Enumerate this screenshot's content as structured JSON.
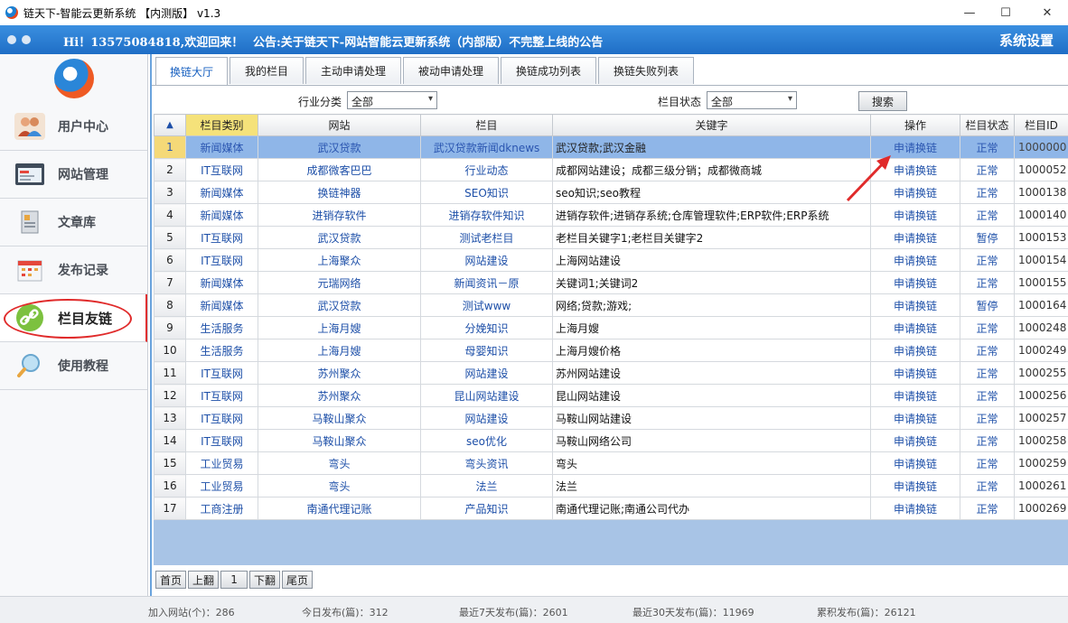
{
  "window": {
    "title": "链天下-智能云更新系统 【内测版】 v1.3",
    "minimize": "—",
    "maximize": "☐",
    "close": "✕"
  },
  "header": {
    "welcome": "Hi！13575084818,欢迎回来！",
    "notice": "公告:关于链天下-网站智能云更新系统（内部版）不完整上线的公告",
    "settings": "系统设置"
  },
  "sidebar": {
    "items": [
      {
        "label": "用户中心",
        "icon": "users-icon"
      },
      {
        "label": "网站管理",
        "icon": "browser-window-icon"
      },
      {
        "label": "文章库",
        "icon": "document-icon"
      },
      {
        "label": "发布记录",
        "icon": "calendar-icon"
      },
      {
        "label": "栏目友链",
        "icon": "link-icon",
        "active": true
      },
      {
        "label": "使用教程",
        "icon": "magnifier-icon"
      }
    ]
  },
  "tabs": [
    "换链大厅",
    "我的栏目",
    "主动申请处理",
    "被动申请处理",
    "换链成功列表",
    "换链失败列表"
  ],
  "filters": {
    "industry_label": "行业分类",
    "industry_value": "全部",
    "status_label": "栏目状态",
    "status_value": "全部",
    "search_button": "搜索"
  },
  "table": {
    "columns": [
      "",
      "栏目类别",
      "网站",
      "栏目",
      "关键字",
      "操作",
      "栏目状态",
      "栏目ID"
    ],
    "sort_indicator": "▲",
    "rows": [
      {
        "n": "1",
        "cat": "新闻媒体",
        "site": "武汉贷款",
        "col": "武汉贷款新闻dknews",
        "kw": "武汉贷款;武汉金融",
        "op": "申请换链",
        "status": "正常",
        "id": "1000000"
      },
      {
        "n": "2",
        "cat": "IT互联网",
        "site": "成都微客巴巴",
        "col": "行业动态",
        "kw": "成都网站建设；成都三级分销；成都微商城",
        "op": "申请换链",
        "status": "正常",
        "id": "1000052"
      },
      {
        "n": "3",
        "cat": "新闻媒体",
        "site": "换链神器",
        "col": "SEO知识",
        "kw": "seo知识;seo教程",
        "op": "申请换链",
        "status": "正常",
        "id": "1000138"
      },
      {
        "n": "4",
        "cat": "新闻媒体",
        "site": "进销存软件",
        "col": "进销存软件知识",
        "kw": "进销存软件;进销存系统;仓库管理软件;ERP软件;ERP系统",
        "op": "申请换链",
        "status": "正常",
        "id": "1000140"
      },
      {
        "n": "5",
        "cat": "IT互联网",
        "site": "武汉贷款",
        "col": "测试老栏目",
        "kw": "老栏目关键字1;老栏目关键字2",
        "op": "申请换链",
        "status": "暂停",
        "id": "1000153"
      },
      {
        "n": "6",
        "cat": "IT互联网",
        "site": "上海聚众",
        "col": "网站建设",
        "kw": "上海网站建设",
        "op": "申请换链",
        "status": "正常",
        "id": "1000154"
      },
      {
        "n": "7",
        "cat": "新闻媒体",
        "site": "元瑞网络",
        "col": "新闻资讯－原",
        "kw": "关键词1;关键词2",
        "op": "申请换链",
        "status": "正常",
        "id": "1000155"
      },
      {
        "n": "8",
        "cat": "新闻媒体",
        "site": "武汉贷款",
        "col": "测试www",
        "kw": "网络;贷款;游戏;",
        "op": "申请换链",
        "status": "暂停",
        "id": "1000164"
      },
      {
        "n": "9",
        "cat": "生活服务",
        "site": "上海月嫂",
        "col": "分娩知识",
        "kw": "上海月嫂",
        "op": "申请换链",
        "status": "正常",
        "id": "1000248"
      },
      {
        "n": "10",
        "cat": "生活服务",
        "site": "上海月嫂",
        "col": "母婴知识",
        "kw": "上海月嫂价格",
        "op": "申请换链",
        "status": "正常",
        "id": "1000249"
      },
      {
        "n": "11",
        "cat": "IT互联网",
        "site": "苏州聚众",
        "col": "网站建设",
        "kw": "苏州网站建设",
        "op": "申请换链",
        "status": "正常",
        "id": "1000255"
      },
      {
        "n": "12",
        "cat": "IT互联网",
        "site": "苏州聚众",
        "col": "昆山网站建设",
        "kw": "昆山网站建设",
        "op": "申请换链",
        "status": "正常",
        "id": "1000256"
      },
      {
        "n": "13",
        "cat": "IT互联网",
        "site": "马鞍山聚众",
        "col": "网站建设",
        "kw": "马鞍山网站建设",
        "op": "申请换链",
        "status": "正常",
        "id": "1000257"
      },
      {
        "n": "14",
        "cat": "IT互联网",
        "site": "马鞍山聚众",
        "col": "seo优化",
        "kw": "马鞍山网络公司",
        "op": "申请换链",
        "status": "正常",
        "id": "1000258"
      },
      {
        "n": "15",
        "cat": "工业贸易",
        "site": "弯头",
        "col": "弯头资讯",
        "kw": "弯头",
        "op": "申请换链",
        "status": "正常",
        "id": "1000259"
      },
      {
        "n": "16",
        "cat": "工业贸易",
        "site": "弯头",
        "col": "法兰",
        "kw": "法兰",
        "op": "申请换链",
        "status": "正常",
        "id": "1000261"
      },
      {
        "n": "17",
        "cat": "工商注册",
        "site": "南通代理记账",
        "col": "产品知识",
        "kw": "南通代理记账;南通公司代办",
        "op": "申请换链",
        "status": "正常",
        "id": "1000269"
      }
    ]
  },
  "pager": {
    "first": "首页",
    "prev": "上翻",
    "page": "1",
    "next": "下翻",
    "last": "尾页"
  },
  "statusbar": {
    "sites": "加入网站(个)：286",
    "today": "今日发布(篇)：312",
    "week": "最近7天发布(篇)：2601",
    "month": "最近30天发布(篇)：11969",
    "total": "累积发布(篇)：26121"
  },
  "colors": {
    "header_blue": "#2a7fd6",
    "link_blue": "#1d4fa8",
    "selected_row": "#8fb6e8",
    "annotation_red": "#e02b2b"
  }
}
